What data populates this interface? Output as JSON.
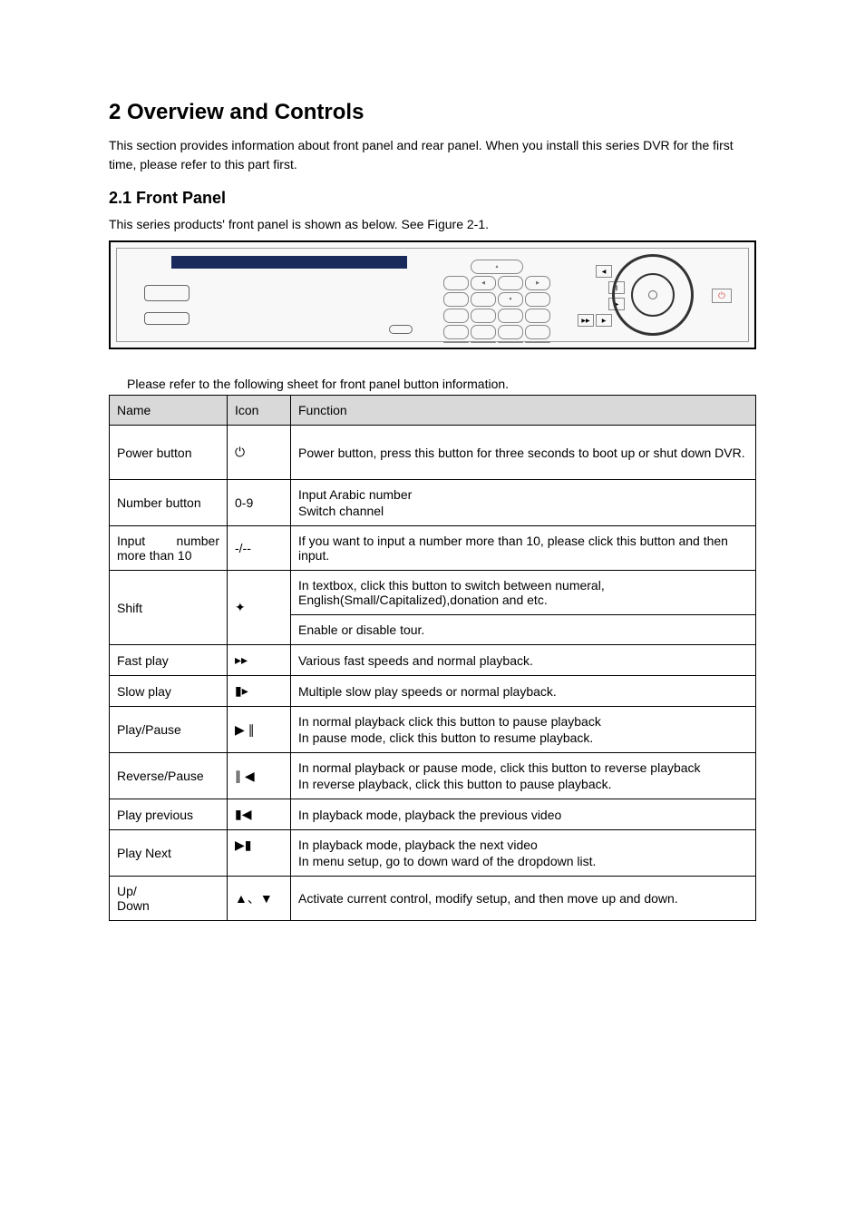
{
  "headings": {
    "h1": "2  Overview and Controls",
    "intro": "This section provides information about front panel and rear panel. When you install this series DVR for the first time, please refer to this part first.",
    "h2": "2.1  Front Panel",
    "sub": "This series products' front panel is shown as below. See Figure 2-1.",
    "sheet_caption": "Please refer to the following sheet for front panel button information."
  },
  "table": {
    "headers": {
      "name": "Name",
      "icon": "Icon",
      "function": "Function"
    },
    "rows": [
      {
        "name": "Power button",
        "icon": "⏻",
        "func": "Power button, press this button for three seconds to boot up or shut down DVR."
      },
      {
        "name": "Number button",
        "icon": "0-9",
        "func_lines": [
          "Input Arabic number",
          "Switch channel"
        ]
      },
      {
        "name_lines": [
          "Input",
          "number",
          "more than 10"
        ],
        "icon": "-/--",
        "func": "If you want to input a number more than 10, please click this button and then input."
      },
      {
        "name": "Shift",
        "icon": "✦",
        "func_lines": [
          "In textbox, click this button to switch between numeral, English(Small/Capitalized),donation and etc.",
          "Enable or disable tour."
        ]
      },
      {
        "name": "Fast play",
        "icon": "▸▸",
        "func": "Various fast speeds and normal playback."
      },
      {
        "name": "Slow play",
        "icon": "▮▸",
        "func": "Multiple slow play speeds or normal playback."
      },
      {
        "name": "Play/Pause",
        "icon": "▶ ∥",
        "func_lines": [
          "In normal playback click this button to pause playback",
          "In pause mode, click this button to resume playback."
        ]
      },
      {
        "name": "Reverse/Pause",
        "icon": "∥ ◀",
        "func_lines": [
          "In normal playback or pause mode, click this button to reverse playback",
          "In reverse playback, click this button to pause playback."
        ]
      },
      {
        "name": "Play previous",
        "icon": "▮◀",
        "func": "In playback mode, playback the previous video"
      },
      {
        "name": "Play Next",
        "icon": "▶▮",
        "func_lines": [
          "In playback mode, playback the next video",
          "In menu setup, go to down ward of the dropdown list."
        ]
      },
      {
        "name_lines2": [
          "Up/",
          "Down"
        ],
        "icon": "▲、▼",
        "func": "Activate current control, modify setup, and then move up and down."
      }
    ]
  },
  "diagram": {
    "power_glyph": "⏻"
  }
}
